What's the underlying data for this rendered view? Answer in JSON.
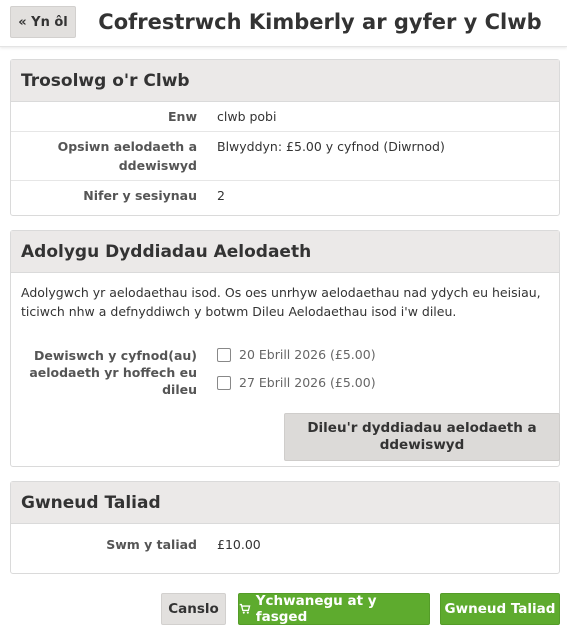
{
  "header": {
    "back_label": "« Yn ôl",
    "title": "Cofrestrwch Kimberly ar gyfer y Clwb"
  },
  "overview": {
    "heading": "Trosolwg o'r Clwb",
    "rows": [
      {
        "label": "Enw",
        "value": "clwb pobi"
      },
      {
        "label": "Opsiwn aelodaeth a ddewiswyd",
        "value": "Blwyddyn: £5.00 y cyfnod (Diwrnod)"
      },
      {
        "label": "Nifer y sesiynau",
        "value": "2"
      }
    ]
  },
  "review": {
    "heading": "Adolygu Dyddiadau Aelodaeth",
    "intro": "Adolygwch yr aelodaethau isod. Os oes unrhyw aelodaethau nad ydych eu heisiau, ticiwch nhw a defnyddiwch y botwm Dileu Aelodaethau isod i'w dileu.",
    "select_label": "Dewiswch y cyfnod(au) aelodaeth yr hoffech eu dileu",
    "options": [
      {
        "label": "20 Ebrill 2026 (£5.00)",
        "checked": false
      },
      {
        "label": "27 Ebrill 2026 (£5.00)",
        "checked": false
      }
    ],
    "delete_label": "Dileu'r dyddiadau aelodaeth a ddewiswyd"
  },
  "payment": {
    "heading": "Gwneud Taliad",
    "amount_label": "Swm y taliad",
    "amount_value": "£10.00"
  },
  "actions": {
    "cancel_label": "Canslo",
    "basket_label": "Ychwanegu at y fasged",
    "basket_icon": "shopping-cart-icon",
    "pay_label": "Gwneud Taliad"
  },
  "colors": {
    "primary_green": "#5eab2e",
    "panel_header": "#ebe9e8",
    "secondary_button": "#e2e0de"
  }
}
